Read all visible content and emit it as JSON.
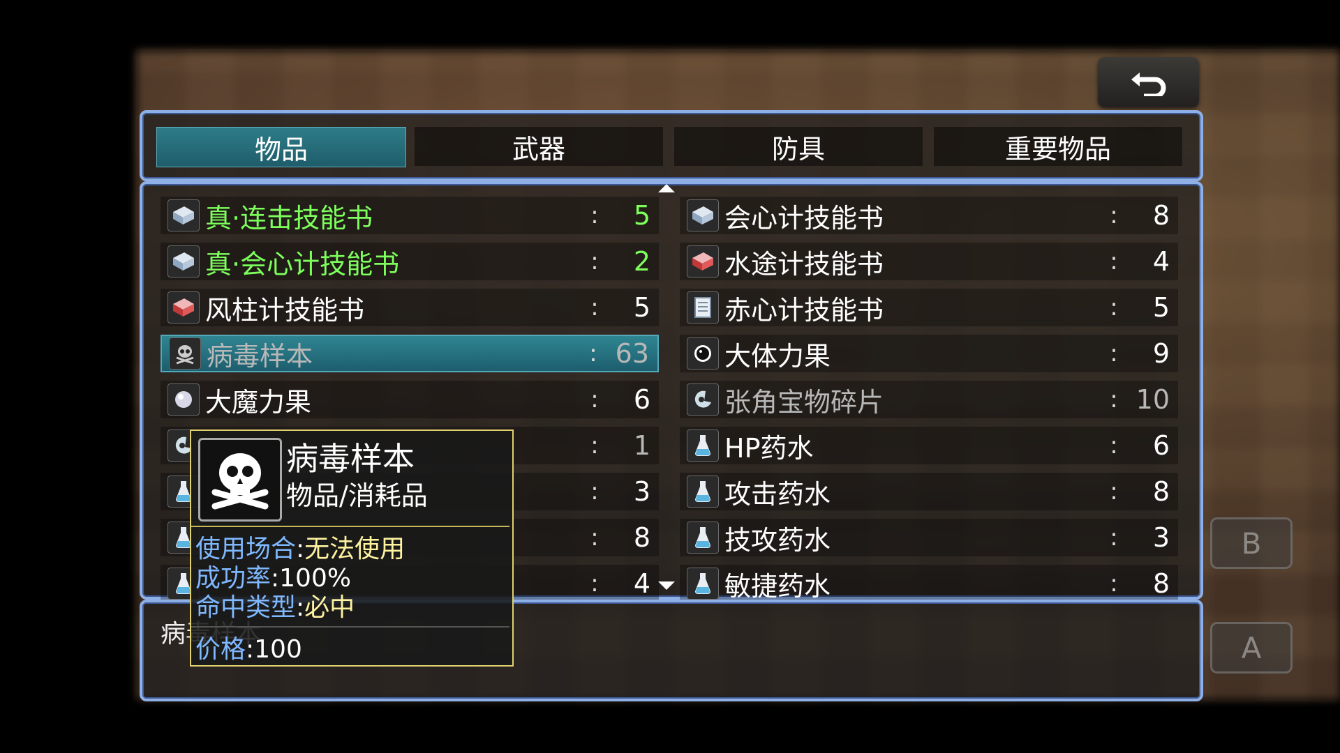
{
  "tabs": [
    {
      "label": "物品",
      "active": true
    },
    {
      "label": "武器",
      "active": false
    },
    {
      "label": "防具",
      "active": false
    },
    {
      "label": "重要物品",
      "active": false
    }
  ],
  "items_left": [
    {
      "name": "真·连击技能书",
      "count": "5",
      "color": "green",
      "icon": "book-icon"
    },
    {
      "name": "真·会心计技能书",
      "count": "2",
      "color": "green",
      "icon": "book-icon"
    },
    {
      "name": "风柱计技能书",
      "count": "5",
      "color": "white",
      "icon": "red-book-icon"
    },
    {
      "name": "病毒样本",
      "count": "63",
      "color": "dim",
      "icon": "skull-icon",
      "selected": true
    },
    {
      "name": "大魔力果",
      "count": "6",
      "color": "white",
      "icon": "white-fruit-icon"
    },
    {
      "name": "",
      "count": "1",
      "color": "dim",
      "icon": "shard-icon"
    },
    {
      "name": "",
      "count": "3",
      "color": "white",
      "icon": "potion-icon"
    },
    {
      "name": "",
      "count": "8",
      "color": "white",
      "icon": "potion-icon"
    },
    {
      "name": "",
      "count": "4",
      "color": "white",
      "icon": "potion-icon"
    }
  ],
  "items_right": [
    {
      "name": "会心计技能书",
      "count": "8",
      "color": "white",
      "icon": "book-icon"
    },
    {
      "name": "水途计技能书",
      "count": "4",
      "color": "white",
      "icon": "red-book-icon"
    },
    {
      "name": "赤心计技能书",
      "count": "5",
      "color": "white",
      "icon": "scroll-icon"
    },
    {
      "name": "大体力果",
      "count": "9",
      "color": "white",
      "icon": "black-fruit-icon"
    },
    {
      "name": "张角宝物碎片",
      "count": "10",
      "color": "dim",
      "icon": "shard-icon"
    },
    {
      "name": "HP药水",
      "count": "6",
      "color": "white",
      "icon": "potion-icon"
    },
    {
      "name": "攻击药水",
      "count": "8",
      "color": "white",
      "icon": "potion-icon"
    },
    {
      "name": "技攻药水",
      "count": "3",
      "color": "white",
      "icon": "potion-icon"
    },
    {
      "name": "敏捷药水",
      "count": "8",
      "color": "white",
      "icon": "potion-icon"
    }
  ],
  "help": {
    "text": "病毒样本"
  },
  "tooltip": {
    "name": "病毒样本",
    "type": "物品/消耗品",
    "use_key": "使用场合",
    "use_val": "无法使用",
    "rate_key": "成功率",
    "rate_val": "100%",
    "hit_key": "命中类型",
    "hit_val": "必中",
    "price_key": "价格",
    "price_val": "100"
  },
  "buttons": {
    "b": "B",
    "a": "A"
  },
  "colors": {
    "accent": "#8fb0e6",
    "selected": "#2f8592",
    "special": "#7dff5c"
  }
}
